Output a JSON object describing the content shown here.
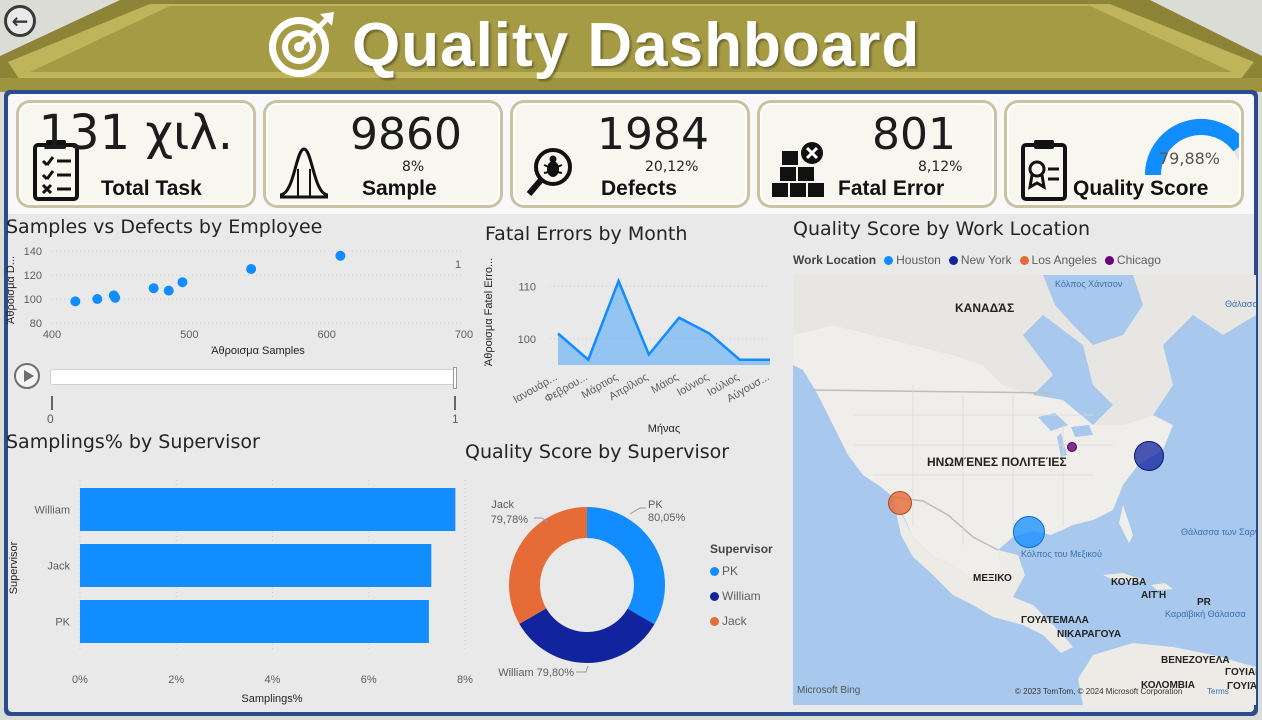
{
  "header": {
    "title": "Quality Dashboard"
  },
  "kpis": [
    {
      "value": "131 χιλ.",
      "percent": "",
      "label": "Total Task",
      "icon": "clipboard-checklist-icon"
    },
    {
      "value": "9860",
      "percent": "8%",
      "label": "Sample",
      "icon": "bell-curve-icon"
    },
    {
      "value": "1984",
      "percent": "20,12%",
      "label": "Defects",
      "icon": "bug-magnifier-icon"
    },
    {
      "value": "801",
      "percent": "8,12%",
      "label": "Fatal Error",
      "icon": "boxes-x-icon"
    },
    {
      "value": "79,88%",
      "percent": "",
      "label": "Quality Score",
      "icon": "badge-clipboard-icon",
      "gauge_fraction": 0.7988
    }
  ],
  "colors": {
    "primary": "#118DFF",
    "navy": "#12239E",
    "orange": "#E66C37",
    "purple": "#6B007B",
    "banner": "#a69b45"
  },
  "scatter": {
    "title": "Samples vs Defects by Employee",
    "chart_data": {
      "type": "scatter",
      "title": "Samples vs Defects by Employee",
      "xlabel": "Άθροισμα Samples",
      "ylabel": "Άθροισμα D...",
      "xlim": [
        400,
        700
      ],
      "ylim": [
        80,
        140
      ],
      "x_ticks": [
        "400",
        "500",
        "600",
        "700"
      ],
      "y_ticks": [
        "80",
        "100",
        "120",
        "140"
      ],
      "points": [
        {
          "x": 417,
          "y": 98
        },
        {
          "x": 433,
          "y": 100
        },
        {
          "x": 445,
          "y": 103
        },
        {
          "x": 446,
          "y": 101
        },
        {
          "x": 474,
          "y": 109
        },
        {
          "x": 485,
          "y": 107
        },
        {
          "x": 495,
          "y": 114
        },
        {
          "x": 545,
          "y": 125
        },
        {
          "x": 610,
          "y": 136
        }
      ],
      "frame_label": "1"
    },
    "play_axis": {
      "start": "0",
      "end": "1"
    }
  },
  "fatal": {
    "title": "Fatal Errors by Month",
    "chart_data": {
      "type": "area",
      "title": "Fatal Errors by Month",
      "xlabel": "Μήνας",
      "ylabel": "Άθροισμα Fatel Erro...",
      "ylim": [
        95,
        115
      ],
      "y_ticks": [
        "100",
        "110"
      ],
      "categories": [
        "Ιανουάρ...",
        "Φεβρου...",
        "Μάρτιος",
        "Απρίλιος",
        "Μάιος",
        "Ιούνιος",
        "Ιούλιος",
        "Αύγουσ..."
      ],
      "values": [
        101,
        96,
        111,
        97,
        104,
        101,
        96,
        96
      ]
    }
  },
  "sampling": {
    "title": "Samplings% by Supervisor",
    "chart_data": {
      "type": "bar",
      "orientation": "horizontal",
      "title": "Samplings% by Supervisor",
      "xlabel": "Samplings%",
      "ylabel": "Supervisor",
      "xlim": [
        0,
        8
      ],
      "x_ticks": [
        "0%",
        "2%",
        "4%",
        "6%",
        "8%"
      ],
      "categories": [
        "William",
        "Jack",
        "PK"
      ],
      "values": [
        7.8,
        7.3,
        7.25
      ]
    }
  },
  "donut": {
    "title": "Quality Score by Supervisor",
    "legend_title": "Supervisor",
    "chart_data": {
      "type": "pie",
      "title": "Quality Score by Supervisor",
      "slices": [
        {
          "name": "PK",
          "value": 80.05,
          "label": "80,05%",
          "color": "#118DFF"
        },
        {
          "name": "William",
          "value": 79.8,
          "label": "William 79,80%",
          "color": "#12239E"
        },
        {
          "name": "Jack",
          "value": 79.78,
          "label": "79,78%",
          "color": "#E66C37"
        }
      ]
    }
  },
  "map": {
    "title": "Quality Score by Work Location",
    "legend_title": "Work Location",
    "legend": [
      {
        "name": "Houston",
        "color": "#118DFF"
      },
      {
        "name": "New York",
        "color": "#12239E"
      },
      {
        "name": "Los Angeles",
        "color": "#E66C37"
      },
      {
        "name": "Chicago",
        "color": "#6B007B"
      }
    ],
    "labels": {
      "canada": "ΚΑΝΑΔΆΣ",
      "usa": "ΗΝΩΜΈΝΕΣ ΠΟΛΙΤΕΊΕΣ",
      "mexico": "ΜΕΞΙΚΟ",
      "cuba": "ΚΟΥΒΑ",
      "haiti": "ΑΙΤΉ",
      "pr": "PR",
      "guatemala": "ΓΟΥΑΤΕΜΑΛΑ",
      "nicaragua": "ΝΙΚΑΡΑΓΟΥΑ",
      "venezuela": "ΒΕΝΕΖΟΥΕΛΑ",
      "colombia": "ΚΟΛΟΜΒΙΑ",
      "guyana": "ΓΟΥΙΑΝΑ",
      "guiana": "ΓΟΥΙΆΝΑ",
      "hudson": "Κόλπος Χάντσον",
      "labrador": "Θάλασσα Λαμπρ...",
      "gulf": "Κόλπος του Μεξικού",
      "sargasso": "Θάλασσα των Σαργασσών",
      "caribbean": "Καραϊβική Θάλασσα",
      "bing": "Microsoft Bing",
      "copyright": "© 2023 TomTom, © 2024 Microsoft Corporation",
      "terms": "Terms"
    }
  }
}
